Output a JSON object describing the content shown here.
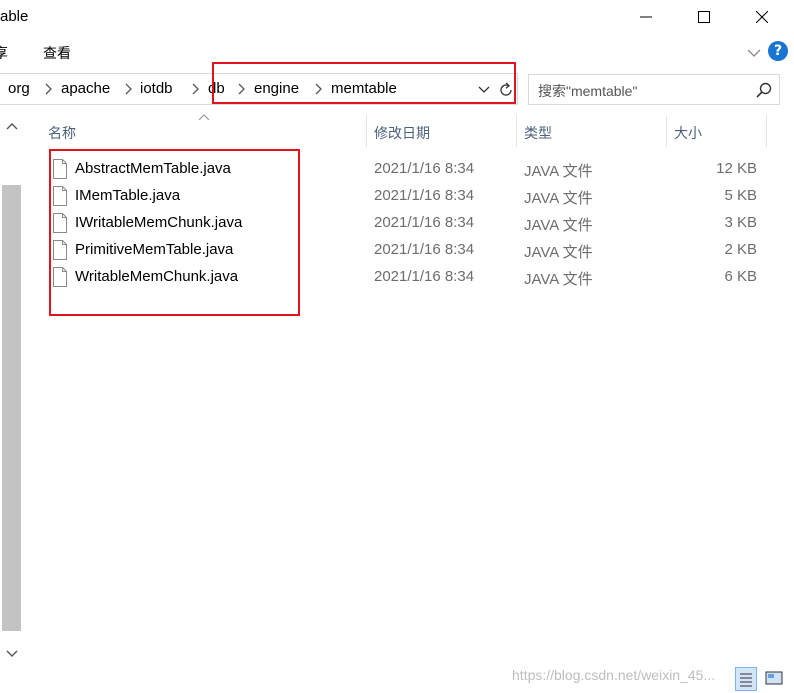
{
  "window": {
    "title": "able",
    "min_icon": "minimize-icon",
    "max_icon": "maximize-icon",
    "close_icon": "close-icon"
  },
  "ribbon": {
    "share_label": "享",
    "view_label": "查看",
    "help_label": "?"
  },
  "breadcrumbs": [
    "org",
    "apache",
    "iotdb",
    "db",
    "engine",
    "memtable"
  ],
  "search": {
    "placeholder": "搜索\"memtable\""
  },
  "columns": {
    "name": "名称",
    "modified": "修改日期",
    "type": "类型",
    "size": "大小"
  },
  "files": [
    {
      "name": "AbstractMemTable.java",
      "modified": "2021/1/16 8:34",
      "type": "JAVA 文件",
      "size": "12 KB"
    },
    {
      "name": "IMemTable.java",
      "modified": "2021/1/16 8:34",
      "type": "JAVA 文件",
      "size": "5 KB"
    },
    {
      "name": "IWritableMemChunk.java",
      "modified": "2021/1/16 8:34",
      "type": "JAVA 文件",
      "size": "3 KB"
    },
    {
      "name": "PrimitiveMemTable.java",
      "modified": "2021/1/16 8:34",
      "type": "JAVA 文件",
      "size": "2 KB"
    },
    {
      "name": "WritableMemChunk.java",
      "modified": "2021/1/16 8:34",
      "type": "JAVA 文件",
      "size": "6 KB"
    }
  ],
  "watermark": "https://blog.csdn.net/weixin_45...",
  "colors": {
    "highlight": "#e0141e",
    "help_blue": "#1a74d2",
    "header_text": "#4c607a"
  }
}
